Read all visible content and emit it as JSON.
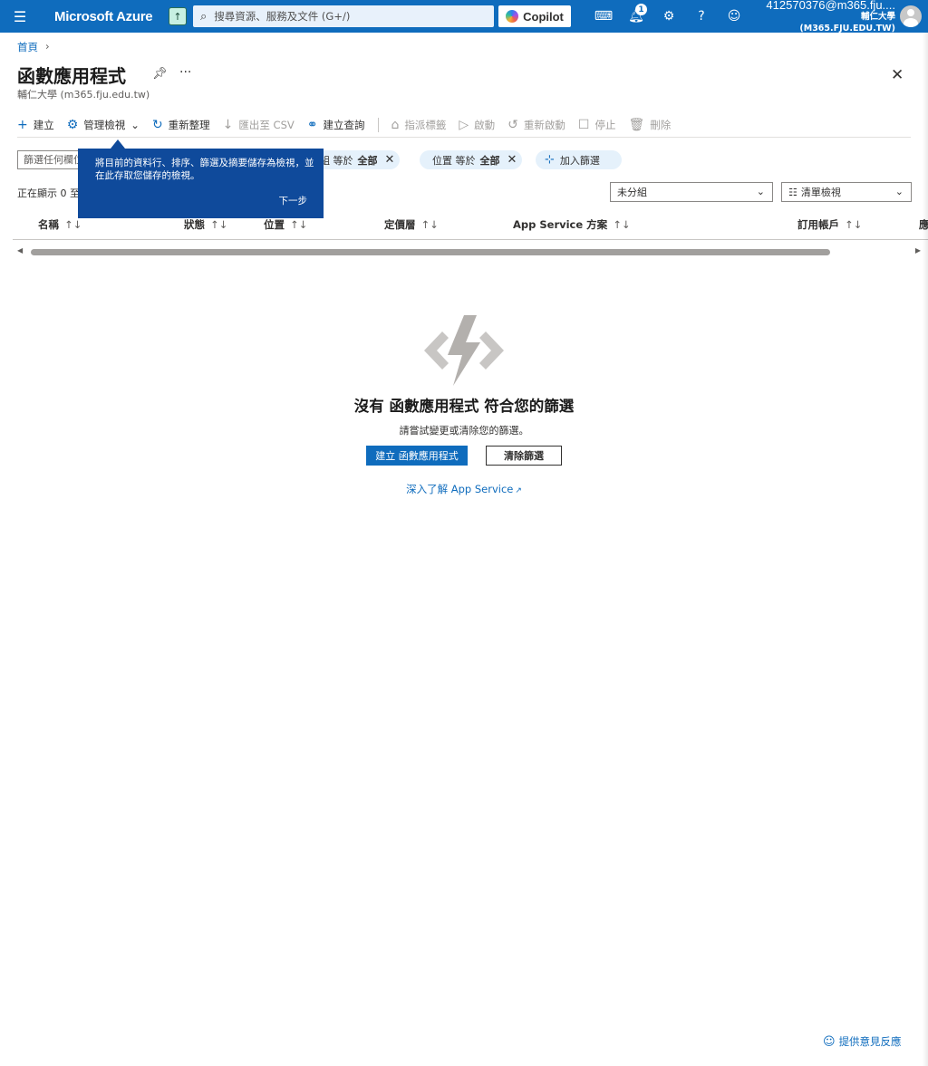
{
  "topbar": {
    "brand": "Microsoft Azure",
    "search_placeholder": "搜尋資源、服務及文件 (G+/)",
    "copilot_label": "Copilot",
    "notification_count": "1",
    "account_email": "412570376@m365.fju....",
    "account_tenant": "輔仁大學 (M365.FJU.EDU.TW)"
  },
  "breadcrumb": {
    "home": "首頁"
  },
  "page": {
    "title": "函數應用程式",
    "subtitle": "輔仁大學 (m365.fju.edu.tw)"
  },
  "commands": {
    "create": "建立",
    "manage_view": "管理檢視",
    "refresh": "重新整理",
    "export_csv": "匯出至 CSV",
    "open_query": "建立查詢",
    "assign_tags": "指派標籤",
    "start": "啟動",
    "restart": "重新啟動",
    "stop": "停止",
    "delete": "刪除"
  },
  "filters": {
    "search_placeholder": "篩選任何欄位...",
    "group_pill_label": "群組 等於",
    "group_pill_value": "全部",
    "location_pill_label": "位置 等於",
    "location_pill_value": "全部",
    "add_filter": "加入篩選"
  },
  "list": {
    "showing": "正在顯示 0 至",
    "grouping_value": "未分組",
    "view_value": "清單檢視",
    "columns": [
      "名稱",
      "狀態",
      "位置",
      "定價層",
      "App Service 方案",
      "訂用帳戶",
      "應"
    ]
  },
  "bubble": {
    "text": "將目前的資料行、排序、篩選及摘要儲存為檢視，並在此存取您儲存的檢視。",
    "next": "下一步"
  },
  "empty": {
    "title": "沒有 函數應用程式 符合您的篩選",
    "subtitle": "請嘗試變更或清除您的篩選。",
    "create_button": "建立 函數應用程式",
    "clear_button": "清除篩選",
    "learn_link": "深入了解 App Service"
  },
  "footer": {
    "feedback": "提供意見反應"
  }
}
